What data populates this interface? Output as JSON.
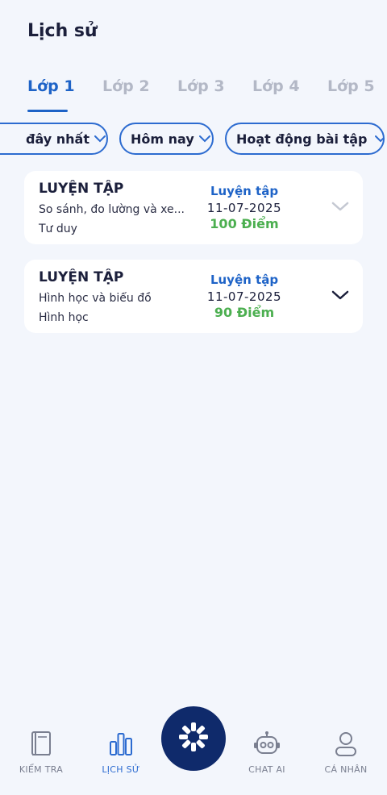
{
  "header": {
    "title": "Lịch sử"
  },
  "tabs": [
    {
      "label": "Lớp 1",
      "active": true
    },
    {
      "label": "Lớp 2",
      "active": false
    },
    {
      "label": "Lớp 3",
      "active": false
    },
    {
      "label": "Lớp 4",
      "active": false
    },
    {
      "label": "Lớp 5",
      "active": false
    }
  ],
  "filters": {
    "sort": {
      "label": "đây nhất"
    },
    "period": {
      "label": "Hôm nay"
    },
    "activity": {
      "label": "Hoạt động bài tập"
    }
  },
  "history": [
    {
      "type": "LUYỆN TẬP",
      "topic": "So sánh, đo lường và xe...",
      "skill": "Tư duy",
      "mode": "Luyện tập",
      "date": "11-07-2025",
      "score": "100 Điểm"
    },
    {
      "type": "LUYỆN TẬP",
      "topic": "Hình học và biểu đồ",
      "skill": "Hình học",
      "mode": "Luyện tập",
      "date": "11-07-2025",
      "score": "90 Điểm"
    }
  ],
  "nav": {
    "test": {
      "label": "KIỂM TRA",
      "icon": "book-icon"
    },
    "history": {
      "label": "LỊCH SỬ",
      "icon": "bar-chart-icon"
    },
    "center": {
      "icon": "wheel-icon"
    },
    "chat": {
      "label": "CHAT AI",
      "icon": "robot-icon"
    },
    "profile": {
      "label": "CÁ NHÂN",
      "icon": "user-icon"
    }
  },
  "colors": {
    "accent": "#1e63c7",
    "score": "#4caf50",
    "fab": "#0f2a6b",
    "background": "#f3f6fc"
  }
}
